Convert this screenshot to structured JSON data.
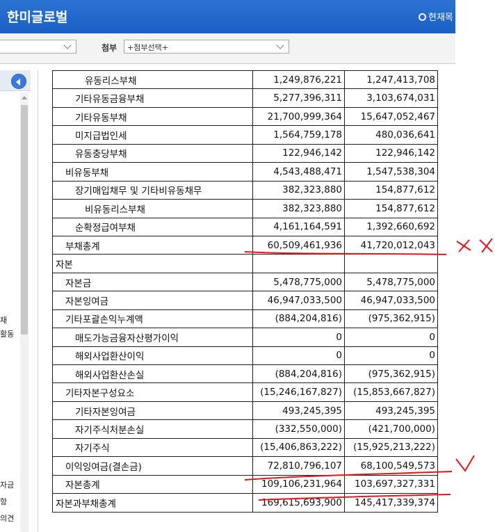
{
  "header": {
    "title": "한미글로벌",
    "right_link": "현재목"
  },
  "toolbar": {
    "select1_value": "",
    "attach_label": "첨부",
    "attach_select_value": "+첨부선택+"
  },
  "left_panel": {
    "fragments": [
      "채",
      "활동",
      "자금",
      "항",
      "의견"
    ]
  },
  "table": {
    "rows": [
      {
        "label": "유동리스부채",
        "indent": 3,
        "cur": "1,249,876,221",
        "prev": "1,247,413,708"
      },
      {
        "label": "기타유동금융부채",
        "indent": 2,
        "cur": "5,277,396,311",
        "prev": "3,103,674,031"
      },
      {
        "label": "기타유동부채",
        "indent": 2,
        "cur": "21,700,999,364",
        "prev": "15,647,052,467"
      },
      {
        "label": "미지급법인세",
        "indent": 2,
        "cur": "1,564,759,178",
        "prev": "480,036,641"
      },
      {
        "label": "유동충당부채",
        "indent": 2,
        "cur": "122,946,142",
        "prev": "122,946,142"
      },
      {
        "label": "비유동부채",
        "indent": 1,
        "cur": "4,543,488,471",
        "prev": "1,547,538,304"
      },
      {
        "label": "장기매입채무 및 기타비유동채무",
        "indent": 2,
        "cur": "382,323,880",
        "prev": "154,877,612"
      },
      {
        "label": "비유동리스부채",
        "indent": 3,
        "cur": "382,323,880",
        "prev": "154,877,612"
      },
      {
        "label": "순확정급여부채",
        "indent": 2,
        "cur": "4,161,164,591",
        "prev": "1,392,660,692"
      },
      {
        "label": "부채총계",
        "indent": 1,
        "cur": "60,509,461,936",
        "prev": "41,720,012,043"
      },
      {
        "label": "자본",
        "indent": 0,
        "cur": "",
        "prev": ""
      },
      {
        "label": "자본금",
        "indent": 1,
        "cur": "5,478,775,000",
        "prev": "5,478,775,000"
      },
      {
        "label": "자본잉여금",
        "indent": 1,
        "cur": "46,947,033,500",
        "prev": "46,947,033,500"
      },
      {
        "label": "기타포괄손익누계액",
        "indent": 1,
        "cur": "(884,204,816)",
        "prev": "(975,362,915)"
      },
      {
        "label": "매도가능금융자산평가이익",
        "indent": 2,
        "cur": "0",
        "prev": "0"
      },
      {
        "label": "해외사업환산이익",
        "indent": 2,
        "cur": "0",
        "prev": "0"
      },
      {
        "label": "해외사업환산손실",
        "indent": 2,
        "cur": "(884,204,816)",
        "prev": "(975,362,915)"
      },
      {
        "label": "기타자본구성요소",
        "indent": 1,
        "cur": "(15,246,167,827)",
        "prev": "(15,853,667,827)"
      },
      {
        "label": "기타자본잉여금",
        "indent": 2,
        "cur": "493,245,395",
        "prev": "493,245,395"
      },
      {
        "label": "자기주식처분손실",
        "indent": 2,
        "cur": "(332,550,000)",
        "prev": "(421,700,000)"
      },
      {
        "label": "자기주식",
        "indent": 2,
        "cur": "(15,406,863,222)",
        "prev": "(15,925,213,222)"
      },
      {
        "label": "이익잉여금(결손금)",
        "indent": 1,
        "cur": "72,810,796,107",
        "prev": "68,100,549,573"
      },
      {
        "label": "자본총계",
        "indent": 1,
        "cur": "109,106,231,964",
        "prev": "103,697,327,331"
      },
      {
        "label": "자본과부채총계",
        "indent": 0,
        "cur": "169,615,693,900",
        "prev": "145,417,339,374"
      }
    ]
  },
  "annotations": {
    "color": "#e8141c"
  }
}
